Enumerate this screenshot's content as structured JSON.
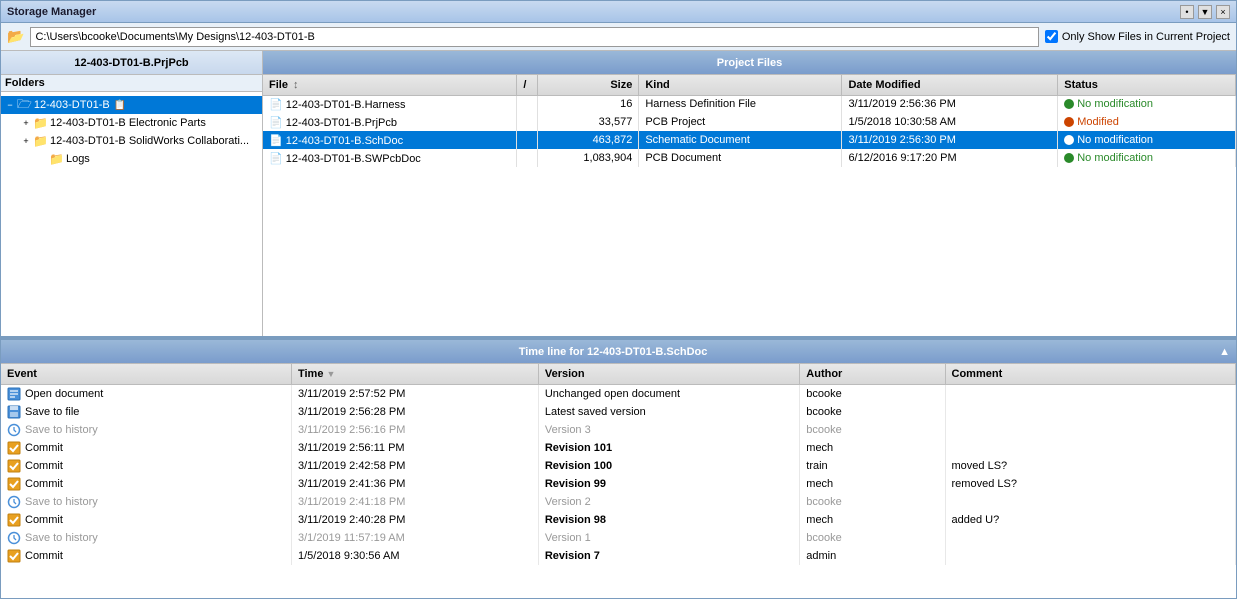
{
  "window": {
    "title": "Storage Manager",
    "controls": [
      "•",
      "▼",
      "×"
    ]
  },
  "toolbar": {
    "path": "C:\\Users\\bcooke\\Documents\\My Designs\\12-403-DT01-B",
    "checkbox_label": "Only Show Files in Current Project",
    "checkbox_checked": true
  },
  "folders_panel": {
    "header": "12-403-DT01-B.PrjPcb",
    "folders_label": "Folders",
    "items": [
      {
        "id": "root",
        "label": "12-403-DT01-B",
        "level": 0,
        "expanded": true,
        "selected": true,
        "has_children": true
      },
      {
        "id": "electronic",
        "label": "12-403-DT01-B Electronic Parts",
        "level": 1,
        "expanded": false,
        "selected": false,
        "has_children": true
      },
      {
        "id": "solidworks",
        "label": "12-403-DT01-B SolidWorks Collaborati...",
        "level": 1,
        "expanded": false,
        "selected": false,
        "has_children": true
      },
      {
        "id": "logs",
        "label": "Logs",
        "level": 2,
        "expanded": false,
        "selected": false,
        "has_children": false
      }
    ]
  },
  "project_files": {
    "header": "Project Files",
    "columns": [
      "File",
      "/",
      "Size",
      "Kind",
      "Date Modified",
      "Status"
    ],
    "rows": [
      {
        "file": "12-403-DT01-B.Harness",
        "separator": "",
        "size": "16",
        "kind": "Harness Definition File",
        "date_modified": "3/11/2019 2:56:36 PM",
        "status": "No modification",
        "status_type": "ok",
        "selected": false
      },
      {
        "file": "12-403-DT01-B.PrjPcb",
        "separator": "",
        "size": "33,577",
        "kind": "PCB Project",
        "date_modified": "1/5/2018 10:30:58 AM",
        "status": "Modified",
        "status_type": "modified",
        "selected": false
      },
      {
        "file": "12-403-DT01-B.SchDoc",
        "separator": "",
        "size": "463,872",
        "kind": "Schematic Document",
        "date_modified": "3/11/2019 2:56:30 PM",
        "status": "No modification",
        "status_type": "ok",
        "selected": true
      },
      {
        "file": "12-403-DT01-B.SWPcbDoc",
        "separator": "",
        "size": "1,083,904",
        "kind": "PCB Document",
        "date_modified": "6/12/2016 9:17:20 PM",
        "status": "No modification",
        "status_type": "ok",
        "selected": false
      }
    ]
  },
  "timeline": {
    "header": "Time line for 12-403-DT01-B.SchDoc",
    "columns": [
      "Event",
      "Time",
      "Version",
      "Author",
      "Comment"
    ],
    "rows": [
      {
        "event": "Open document",
        "icon": "doc",
        "time": "3/11/2019 2:57:52 PM",
        "version": "Unchanged open document",
        "author": "bcooke",
        "comment": "",
        "grayed": false,
        "bold": false
      },
      {
        "event": "Save to file",
        "icon": "save",
        "time": "3/11/2019 2:56:28 PM",
        "version": "Latest saved version",
        "author": "bcooke",
        "comment": "",
        "grayed": false,
        "bold": false
      },
      {
        "event": "Save to history",
        "icon": "history",
        "time": "3/11/2019 2:56:16 PM",
        "version": "Version 3",
        "author": "bcooke",
        "comment": "",
        "grayed": true,
        "bold": false
      },
      {
        "event": "Commit",
        "icon": "commit",
        "time": "3/11/2019 2:56:11 PM",
        "version": "Revision 101",
        "author": "mech",
        "comment": "",
        "grayed": false,
        "bold": true
      },
      {
        "event": "Commit",
        "icon": "commit",
        "time": "3/11/2019 2:42:58 PM",
        "version": "Revision 100",
        "author": "train",
        "comment": "moved LS?",
        "grayed": false,
        "bold": true
      },
      {
        "event": "Commit",
        "icon": "commit",
        "time": "3/11/2019 2:41:36 PM",
        "version": "Revision 99",
        "author": "mech",
        "comment": "removed LS?",
        "grayed": false,
        "bold": true
      },
      {
        "event": "Save to history",
        "icon": "history",
        "time": "3/11/2019 2:41:18 PM",
        "version": "Version 2",
        "author": "bcooke",
        "comment": "",
        "grayed": true,
        "bold": false
      },
      {
        "event": "Commit",
        "icon": "commit",
        "time": "3/11/2019 2:40:28 PM",
        "version": "Revision 98",
        "author": "mech",
        "comment": "added U?",
        "grayed": false,
        "bold": true
      },
      {
        "event": "Save to history",
        "icon": "history",
        "time": "3/1/2019 11:57:19 AM",
        "version": "Version 1",
        "author": "bcooke",
        "comment": "",
        "grayed": true,
        "bold": false
      },
      {
        "event": "Commit",
        "icon": "commit",
        "time": "1/5/2018 9:30:56 AM",
        "version": "Revision 7",
        "author": "admin",
        "comment": "",
        "grayed": false,
        "bold": true
      }
    ]
  },
  "icons": {
    "folder_open": "📂",
    "folder_closed": "📁",
    "doc": "📄",
    "expand": "−",
    "collapse": "+",
    "check": "✔",
    "arrow_up": "▲",
    "arrow_down": "▼"
  }
}
